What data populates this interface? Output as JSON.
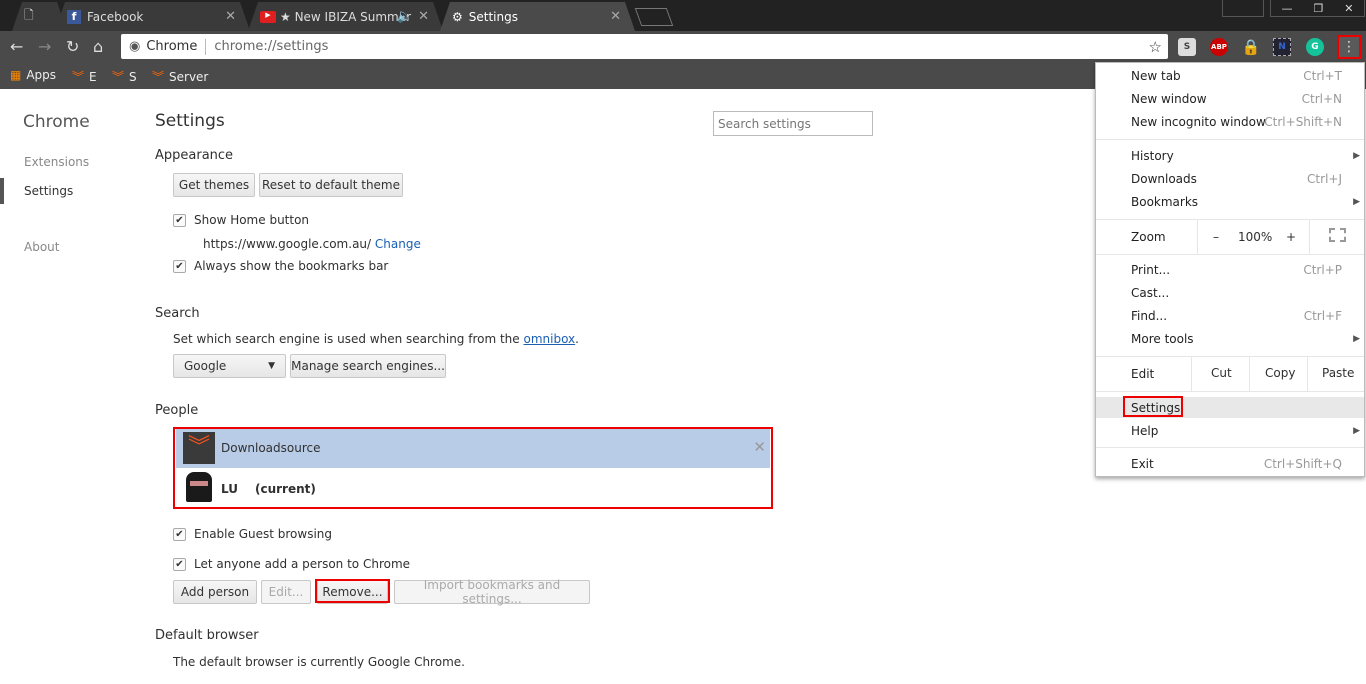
{
  "tabs": [
    {
      "label": ""
    },
    {
      "label": "Facebook"
    },
    {
      "label": "★ New IBIZA Summer"
    },
    {
      "label": "Settings"
    }
  ],
  "omnibox": {
    "site": "Chrome",
    "url": "chrome://settings"
  },
  "bookmarks": [
    {
      "label": "Apps"
    },
    {
      "label": "E"
    },
    {
      "label": "S"
    },
    {
      "label": "Server"
    }
  ],
  "extensions": [
    {
      "name": "S"
    },
    {
      "name": "ABP"
    },
    {
      "name": "lock"
    },
    {
      "name": "N"
    },
    {
      "name": "G"
    }
  ],
  "sidebar": {
    "title": "Chrome",
    "items": [
      {
        "label": "Extensions"
      },
      {
        "label": "Settings"
      },
      {
        "label": "About"
      }
    ]
  },
  "settings": {
    "title": "Settings",
    "search_placeholder": "Search settings",
    "appearance": {
      "heading": "Appearance",
      "get_themes": "Get themes",
      "reset_theme": "Reset to default theme",
      "show_home": "Show Home button",
      "home_url": "https://www.google.com.au/",
      "change": "Change",
      "show_bookmarks": "Always show the bookmarks bar"
    },
    "search": {
      "heading": "Search",
      "desc": "Set which search engine is used when searching from the",
      "omnibox_link": "omnibox",
      "engine": "Google",
      "manage": "Manage search engines..."
    },
    "people": {
      "heading": "People",
      "profiles": [
        {
          "name": "Downloadsource",
          "status": ""
        },
        {
          "name": "LU",
          "status": "(current)"
        }
      ],
      "guest": "Enable Guest browsing",
      "anyone_add": "Let anyone add a person to Chrome",
      "add": "Add person",
      "edit": "Edit...",
      "remove": "Remove...",
      "import": "Import bookmarks and settings..."
    },
    "default_browser": {
      "heading": "Default browser",
      "desc": "The default browser is currently Google Chrome."
    }
  },
  "menu": {
    "new_tab": "New tab",
    "new_tab_sc": "Ctrl+T",
    "new_window": "New window",
    "new_window_sc": "Ctrl+N",
    "incognito": "New incognito window",
    "incognito_sc": "Ctrl+Shift+N",
    "history": "History",
    "downloads": "Downloads",
    "downloads_sc": "Ctrl+J",
    "bookmarks": "Bookmarks",
    "zoom": "Zoom",
    "zoom_minus": "–",
    "zoom_level": "100%",
    "zoom_plus": "+",
    "print": "Print...",
    "print_sc": "Ctrl+P",
    "cast": "Cast...",
    "find": "Find...",
    "find_sc": "Ctrl+F",
    "more_tools": "More tools",
    "edit": "Edit",
    "cut": "Cut",
    "copy": "Copy",
    "paste": "Paste",
    "settings": "Settings",
    "help": "Help",
    "exit": "Exit",
    "exit_sc": "Ctrl+Shift+Q"
  },
  "colors": {
    "highlight": "#e00000",
    "profile_selected": "#b8cce8",
    "link": "#1a5fb4"
  }
}
